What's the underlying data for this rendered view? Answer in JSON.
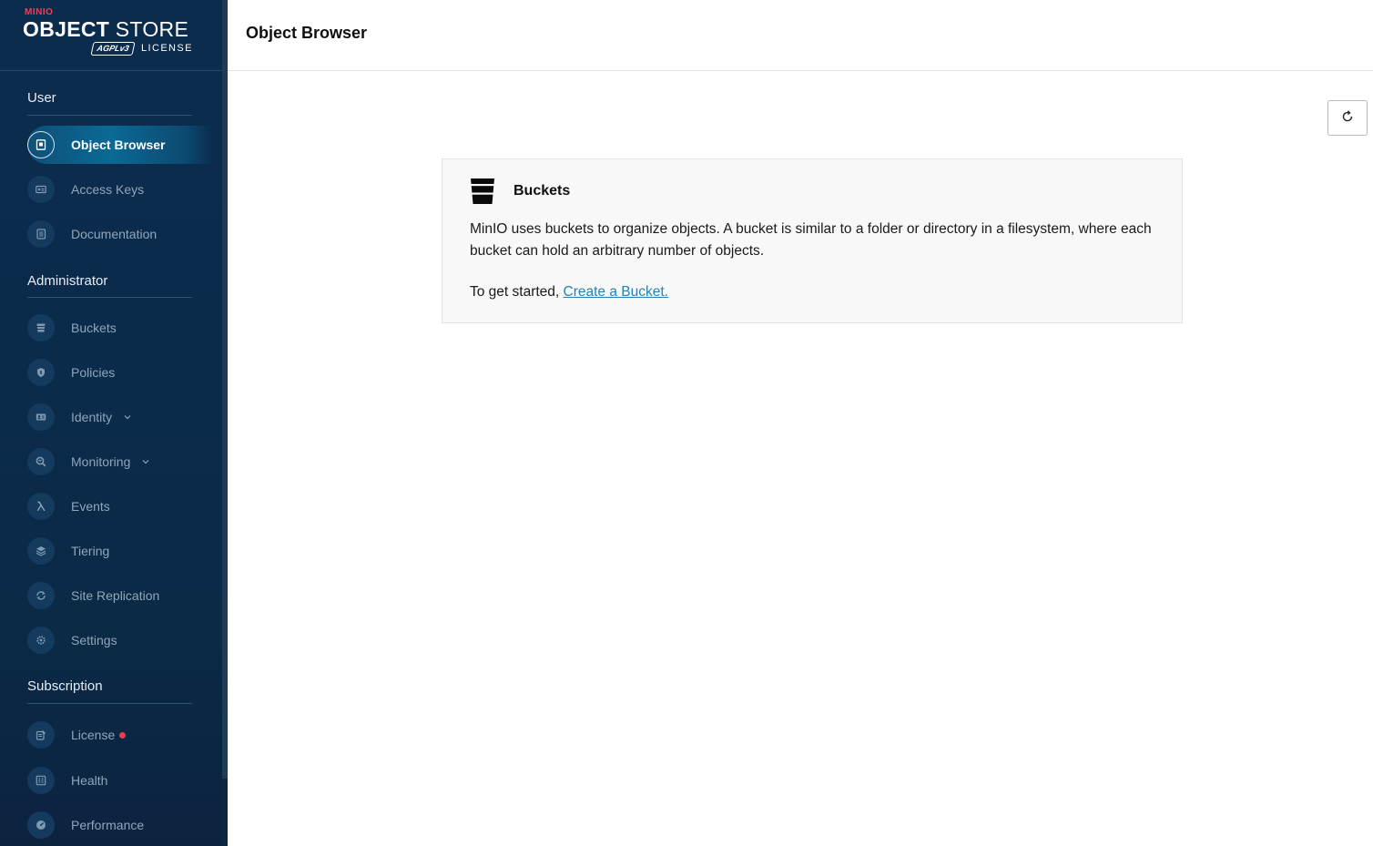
{
  "brand": {
    "minio": "MINIO",
    "product_bold": "OBJECT",
    "product_light": " STORE",
    "agpl": "AGPLv3",
    "license": "LICENSE"
  },
  "sidebar": {
    "sections": [
      {
        "title": "User"
      },
      {
        "title": "Administrator"
      },
      {
        "title": "Subscription"
      }
    ],
    "items": [
      {
        "label": "Object Browser",
        "icon": "object-browser-icon",
        "active": true
      },
      {
        "label": "Access Keys",
        "icon": "access-keys-icon"
      },
      {
        "label": "Documentation",
        "icon": "documentation-icon"
      },
      {
        "label": "Buckets",
        "icon": "bucket-icon"
      },
      {
        "label": "Policies",
        "icon": "policies-icon"
      },
      {
        "label": "Identity",
        "icon": "identity-icon",
        "expandable": true
      },
      {
        "label": "Monitoring",
        "icon": "monitoring-icon",
        "expandable": true
      },
      {
        "label": "Events",
        "icon": "lambda-icon"
      },
      {
        "label": "Tiering",
        "icon": "tiering-icon"
      },
      {
        "label": "Site Replication",
        "icon": "site-replication-icon"
      },
      {
        "label": "Settings",
        "icon": "settings-icon"
      },
      {
        "label": "License",
        "icon": "license-icon",
        "badge": "red-dot"
      },
      {
        "label": "Health",
        "icon": "health-icon"
      },
      {
        "label": "Performance",
        "icon": "performance-icon"
      }
    ]
  },
  "header": {
    "title": "Object Browser"
  },
  "toolbar": {
    "refresh_icon": "refresh-icon"
  },
  "empty_state": {
    "icon": "bucket-icon",
    "title": "Buckets",
    "description": "MinIO uses buckets to organize objects. A bucket is similar to a folder or directory in a filesystem, where each bucket can hold an arbitrary number of objects.",
    "cta_prefix": "To get started, ",
    "cta_link": "Create a Bucket."
  },
  "colors": {
    "sidebar_bg": "#0b2c4d",
    "active_item": "#0a6a95",
    "brand_red": "#e7405d",
    "link": "#2781b0",
    "badge": "#f03b52"
  }
}
